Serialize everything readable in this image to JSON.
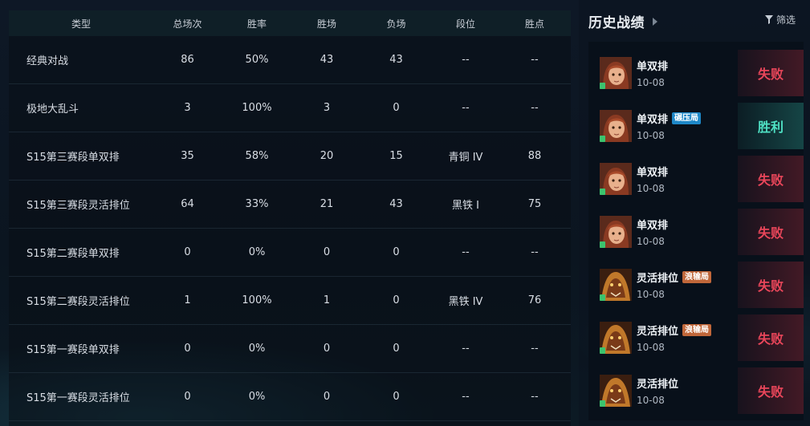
{
  "table": {
    "headers": [
      "类型",
      "总场次",
      "胜率",
      "胜场",
      "负场",
      "段位",
      "胜点"
    ],
    "rows": [
      [
        "经典对战",
        "86",
        "50%",
        "43",
        "43",
        "--",
        "--"
      ],
      [
        "极地大乱斗",
        "3",
        "100%",
        "3",
        "0",
        "--",
        "--"
      ],
      [
        "S15第三赛段单双排",
        "35",
        "58%",
        "20",
        "15",
        "青铜 IV",
        "88"
      ],
      [
        "S15第三赛段灵活排位",
        "64",
        "33%",
        "21",
        "43",
        "黑铁 Ⅰ",
        "75"
      ],
      [
        "S15第二赛段单双排",
        "0",
        "0%",
        "0",
        "0",
        "--",
        "--"
      ],
      [
        "S15第二赛段灵活排位",
        "1",
        "100%",
        "1",
        "0",
        "黑铁 IV",
        "76"
      ],
      [
        "S15第一赛段单双排",
        "0",
        "0%",
        "0",
        "0",
        "--",
        "--"
      ],
      [
        "S15第一赛段灵活排位",
        "0",
        "0%",
        "0",
        "0",
        "--",
        "--"
      ]
    ]
  },
  "history": {
    "title": "历史战绩",
    "filter_label": "筛选",
    "matches": [
      {
        "mode": "单双排",
        "tag": "",
        "date": "10-08",
        "result": "失败",
        "win": false,
        "champion": "girl-champion-portrait"
      },
      {
        "mode": "单双排",
        "tag": "碾压局",
        "tag_color": "#1e88c8",
        "date": "10-08",
        "result": "胜利",
        "win": true,
        "champion": "girl-champion-portrait"
      },
      {
        "mode": "单双排",
        "tag": "",
        "date": "10-08",
        "result": "失败",
        "win": false,
        "champion": "girl-champion-portrait"
      },
      {
        "mode": "单双排",
        "tag": "",
        "date": "10-08",
        "result": "失败",
        "win": false,
        "champion": "girl-champion-portrait"
      },
      {
        "mode": "灵活排位",
        "tag": "浪输局",
        "tag_color": "#c0673a",
        "date": "10-08",
        "result": "失败",
        "win": false,
        "champion": "beast-champion-portrait"
      },
      {
        "mode": "灵活排位",
        "tag": "浪输局",
        "tag_color": "#c0673a",
        "date": "10-08",
        "result": "失败",
        "win": false,
        "champion": "beast-champion-portrait"
      },
      {
        "mode": "灵活排位",
        "tag": "",
        "date": "10-08",
        "result": "失败",
        "win": false,
        "champion": "beast-champion-portrait"
      }
    ]
  },
  "colors": {
    "loss": "#e9465a",
    "win": "#4fe1c4",
    "level_badge": "#3cc36e"
  }
}
